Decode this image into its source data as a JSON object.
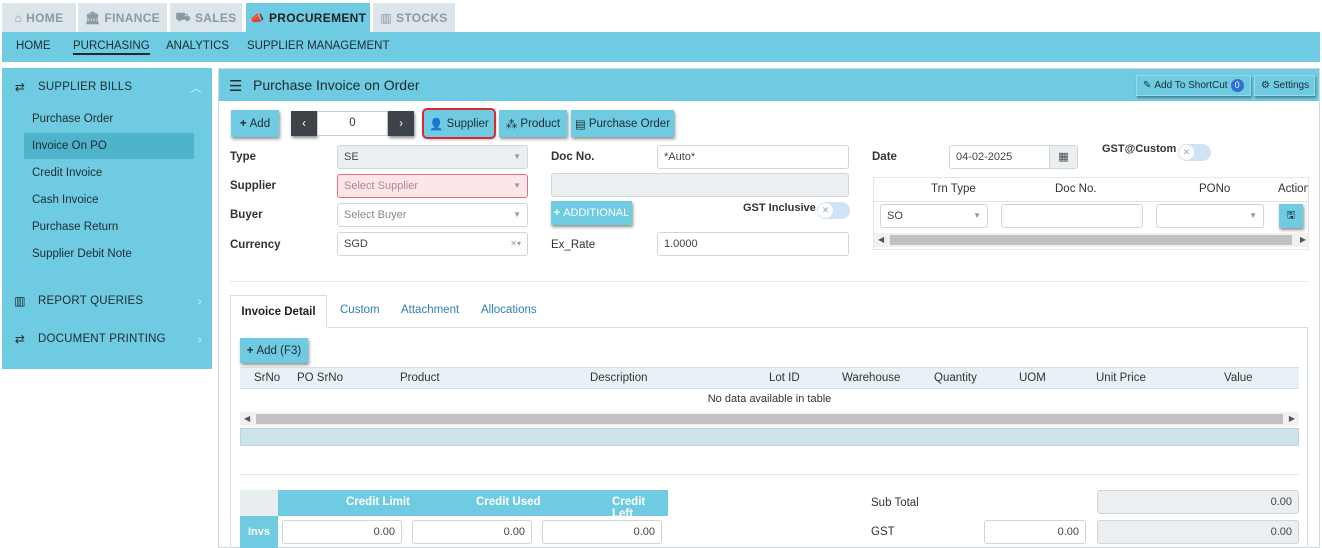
{
  "modules": [
    {
      "label": "HOME",
      "icon": "home-icon",
      "glyph": "⌂"
    },
    {
      "label": "FINANCE",
      "icon": "bank-icon",
      "glyph": "🏛"
    },
    {
      "label": "SALES",
      "icon": "cart-icon",
      "glyph": "🛒"
    },
    {
      "label": "PROCUREMENT",
      "icon": "megaphone-icon",
      "glyph": "📢"
    },
    {
      "label": "STOCKS",
      "icon": "bar-chart-icon",
      "glyph": "▮"
    }
  ],
  "subnav": [
    "HOME",
    "PURCHASING",
    "ANALYTICS",
    "SUPPLIER MANAGEMENT"
  ],
  "sidebar": {
    "group1": "SUPPLIER BILLS",
    "items": [
      "Purchase Order",
      "Invoice On PO",
      "Credit Invoice",
      "Cash Invoice",
      "Purchase Return",
      "Supplier Debit Note"
    ],
    "group2": "REPORT QUERIES",
    "group3": "DOCUMENT PRINTING"
  },
  "panel": {
    "title": "Purchase Invoice on Order",
    "shortcut_label": "Add To ShortCut",
    "shortcut_count": "0",
    "settings_label": "Settings"
  },
  "toolbar": {
    "add": "Add",
    "counter": "0",
    "supplier": "Supplier",
    "product": "Product",
    "purchase_order": "Purchase Order"
  },
  "form": {
    "type_label": "Type",
    "type_value": "SE",
    "supplier_label": "Supplier",
    "supplier_placeholder": "Select Supplier",
    "buyer_label": "Buyer",
    "buyer_placeholder": "Select Buyer",
    "currency_label": "Currency",
    "currency_value": "SGD",
    "docno_label": "Doc No.",
    "docno_value": "*Auto*",
    "additional": "ADDITIONAL",
    "gst_inclusive": "GST Inclusive",
    "exrate_label": "Ex_Rate",
    "exrate_value": "1.0000",
    "date_label": "Date",
    "date_value": "04-02-2025",
    "gst_custom": "GST@Custom"
  },
  "mini_table": {
    "headers": [
      "Trn Type",
      "Doc No.",
      "PONo",
      "Action"
    ],
    "row_trn": "SO"
  },
  "tabs": [
    "Invoice Detail",
    "Custom",
    "Attachment",
    "Allocations"
  ],
  "detail": {
    "add": "Add (F3)",
    "columns": [
      "SrNo",
      "PO SrNo",
      "Product",
      "Description",
      "Lot ID",
      "Warehouse",
      "Quantity",
      "UOM",
      "Unit Price",
      "Value"
    ],
    "empty": "No data available in table"
  },
  "credit": {
    "headers": [
      "Credit Limit",
      "Credit Used",
      "Credit Left"
    ],
    "row_label": "Invs",
    "values": [
      "0.00",
      "0.00",
      "0.00"
    ]
  },
  "totals": {
    "subtotal_label": "Sub Total",
    "subtotal_value": "0.00",
    "gst_label": "GST",
    "gst_rate_value": "0.00",
    "gst_value": "0.00"
  },
  "colors": {
    "accent": "#6ecbe1",
    "highlight": "#d9292f"
  }
}
